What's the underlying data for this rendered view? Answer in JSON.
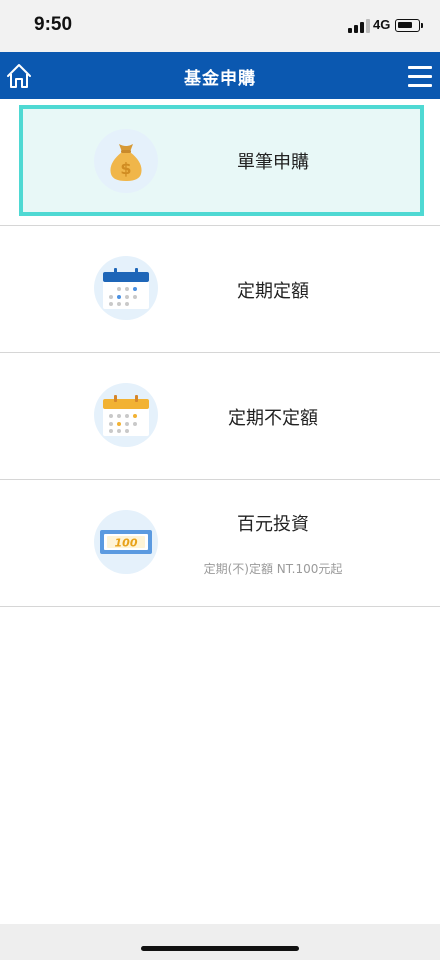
{
  "status_bar": {
    "time": "9:50",
    "network": "4G"
  },
  "header": {
    "title": "基金申購",
    "home_icon": "home-icon",
    "menu_icon": "hamburger-menu-icon",
    "background": "#0b58b0"
  },
  "options": [
    {
      "label": "單筆申購",
      "icon": "money-bag-icon",
      "selected": true
    },
    {
      "label": "定期定額",
      "icon": "calendar-blue-icon"
    },
    {
      "label": "定期不定額",
      "icon": "calendar-yellow-icon"
    },
    {
      "label": "百元投資",
      "sublabel": "定期(不)定額 NT.100元起",
      "icon": "banknote-100-icon",
      "banknote_text": "100"
    }
  ],
  "colors": {
    "selected_border": "#4fd9d3",
    "selected_background": "#e8f8f7"
  }
}
